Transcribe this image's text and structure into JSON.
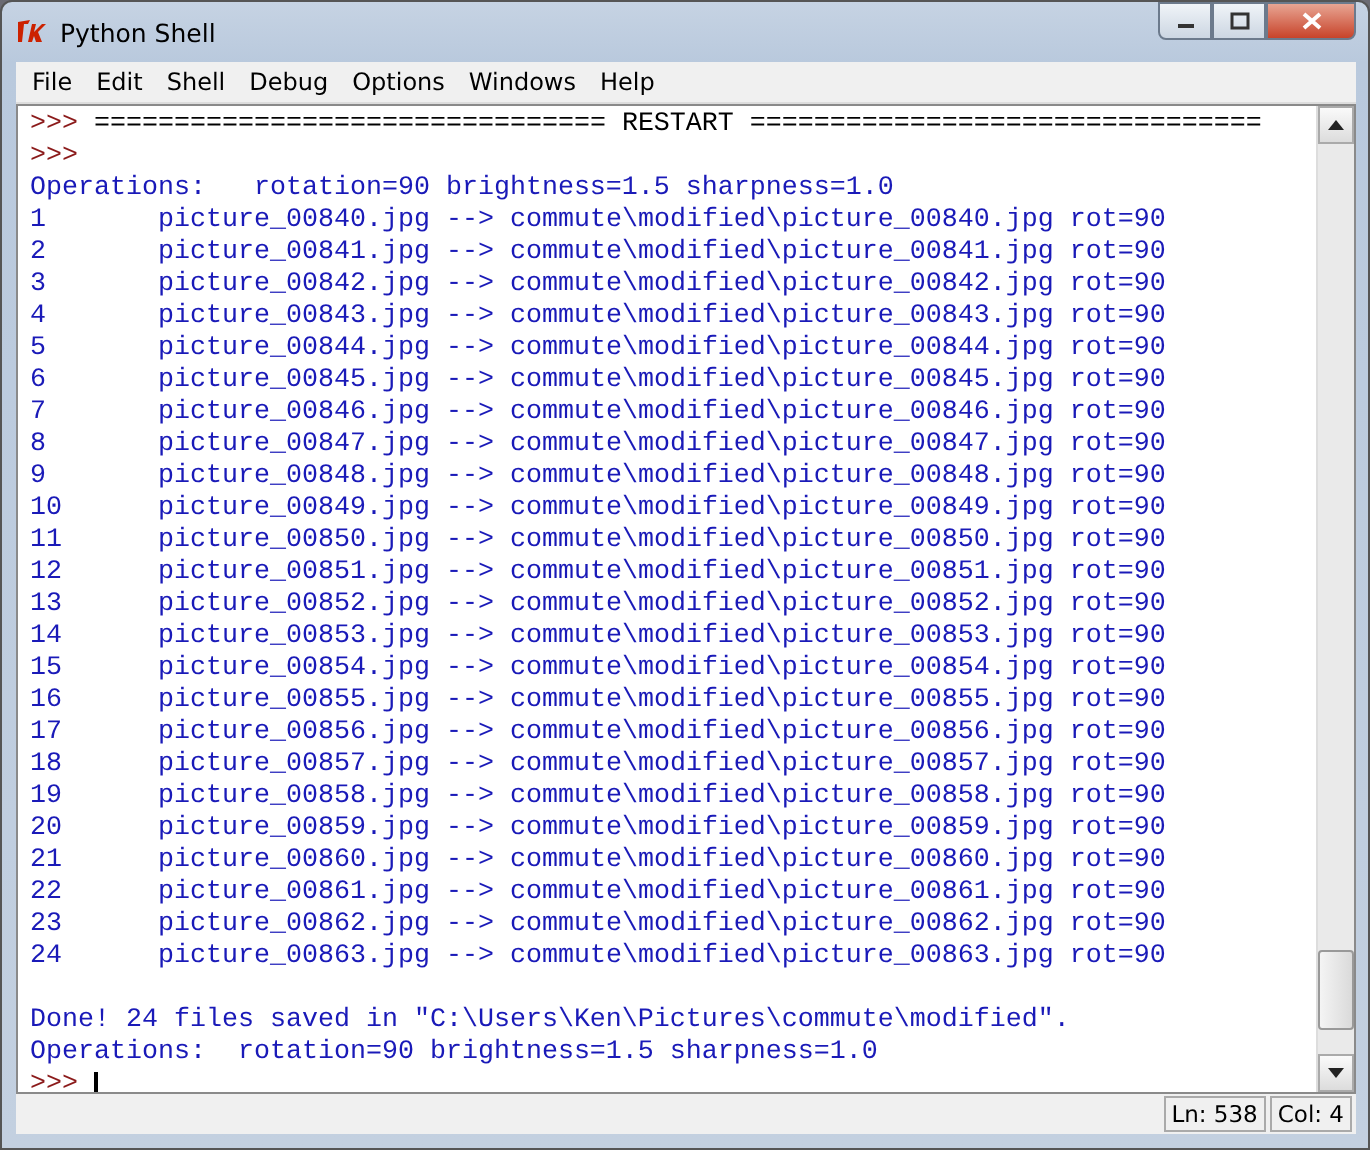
{
  "window": {
    "title": "Python Shell"
  },
  "menu": [
    "File",
    "Edit",
    "Shell",
    "Debug",
    "Options",
    "Windows",
    "Help"
  ],
  "lines": [
    {
      "kind": "restart",
      "prompt": ">>>",
      "text": "================================ RESTART ================================"
    },
    {
      "kind": "prompt",
      "prompt": ">>>"
    },
    {
      "kind": "output",
      "text": "Operations:   rotation=90 brightness=1.5 sharpness=1.0"
    },
    {
      "kind": "row",
      "index": "1",
      "text": "picture_00840.jpg --> commute\\modified\\picture_00840.jpg rot=90"
    },
    {
      "kind": "row",
      "index": "2",
      "text": "picture_00841.jpg --> commute\\modified\\picture_00841.jpg rot=90"
    },
    {
      "kind": "row",
      "index": "3",
      "text": "picture_00842.jpg --> commute\\modified\\picture_00842.jpg rot=90"
    },
    {
      "kind": "row",
      "index": "4",
      "text": "picture_00843.jpg --> commute\\modified\\picture_00843.jpg rot=90"
    },
    {
      "kind": "row",
      "index": "5",
      "text": "picture_00844.jpg --> commute\\modified\\picture_00844.jpg rot=90"
    },
    {
      "kind": "row",
      "index": "6",
      "text": "picture_00845.jpg --> commute\\modified\\picture_00845.jpg rot=90"
    },
    {
      "kind": "row",
      "index": "7",
      "text": "picture_00846.jpg --> commute\\modified\\picture_00846.jpg rot=90"
    },
    {
      "kind": "row",
      "index": "8",
      "text": "picture_00847.jpg --> commute\\modified\\picture_00847.jpg rot=90"
    },
    {
      "kind": "row",
      "index": "9",
      "text": "picture_00848.jpg --> commute\\modified\\picture_00848.jpg rot=90"
    },
    {
      "kind": "row",
      "index": "10",
      "text": "picture_00849.jpg --> commute\\modified\\picture_00849.jpg rot=90"
    },
    {
      "kind": "row",
      "index": "11",
      "text": "picture_00850.jpg --> commute\\modified\\picture_00850.jpg rot=90"
    },
    {
      "kind": "row",
      "index": "12",
      "text": "picture_00851.jpg --> commute\\modified\\picture_00851.jpg rot=90"
    },
    {
      "kind": "row",
      "index": "13",
      "text": "picture_00852.jpg --> commute\\modified\\picture_00852.jpg rot=90"
    },
    {
      "kind": "row",
      "index": "14",
      "text": "picture_00853.jpg --> commute\\modified\\picture_00853.jpg rot=90"
    },
    {
      "kind": "row",
      "index": "15",
      "text": "picture_00854.jpg --> commute\\modified\\picture_00854.jpg rot=90"
    },
    {
      "kind": "row",
      "index": "16",
      "text": "picture_00855.jpg --> commute\\modified\\picture_00855.jpg rot=90"
    },
    {
      "kind": "row",
      "index": "17",
      "text": "picture_00856.jpg --> commute\\modified\\picture_00856.jpg rot=90"
    },
    {
      "kind": "row",
      "index": "18",
      "text": "picture_00857.jpg --> commute\\modified\\picture_00857.jpg rot=90"
    },
    {
      "kind": "row",
      "index": "19",
      "text": "picture_00858.jpg --> commute\\modified\\picture_00858.jpg rot=90"
    },
    {
      "kind": "row",
      "index": "20",
      "text": "picture_00859.jpg --> commute\\modified\\picture_00859.jpg rot=90"
    },
    {
      "kind": "row",
      "index": "21",
      "text": "picture_00860.jpg --> commute\\modified\\picture_00860.jpg rot=90"
    },
    {
      "kind": "row",
      "index": "22",
      "text": "picture_00861.jpg --> commute\\modified\\picture_00861.jpg rot=90"
    },
    {
      "kind": "row",
      "index": "23",
      "text": "picture_00862.jpg --> commute\\modified\\picture_00862.jpg rot=90"
    },
    {
      "kind": "row",
      "index": "24",
      "text": "picture_00863.jpg --> commute\\modified\\picture_00863.jpg rot=90"
    },
    {
      "kind": "blank"
    },
    {
      "kind": "output",
      "text": "Done! 24 files saved in \"C:\\Users\\Ken\\Pictures\\commute\\modified\"."
    },
    {
      "kind": "output",
      "text": "Operations:  rotation=90 brightness=1.5 sharpness=1.0"
    },
    {
      "kind": "input",
      "prompt": ">>>"
    }
  ],
  "status_bar": {
    "line": "Ln: 538",
    "column": "Col: 4"
  }
}
